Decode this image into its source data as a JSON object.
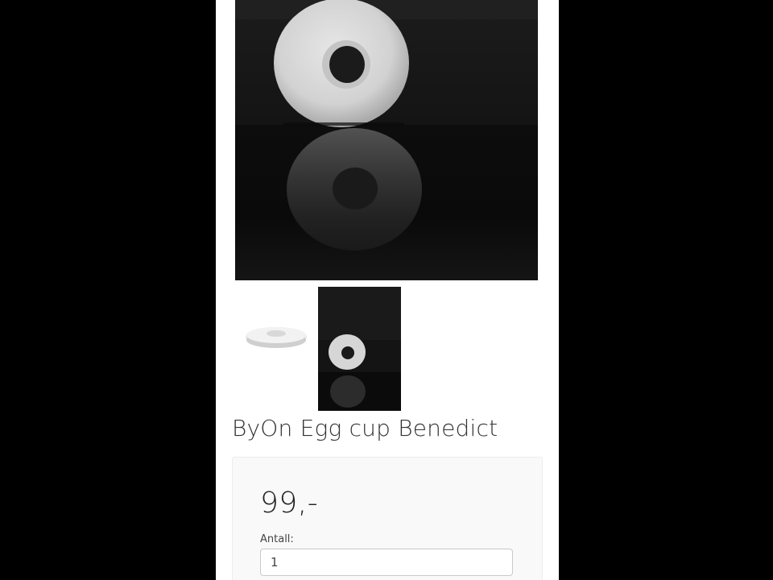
{
  "product": {
    "title": "ByOn Egg cup Benedict",
    "price": "99,-",
    "quantity_label": "Antall:",
    "quantity_value": "1"
  },
  "images": {
    "main": "product-photo-egg-cup-dark",
    "thumbnails": [
      "thumbnail-egg-cup-white",
      "thumbnail-egg-cup-dark"
    ]
  },
  "colors": {
    "page_background": "#000000",
    "content_background": "#ffffff",
    "photo_background": "#111111",
    "buy_box_background": "#f9f9f9"
  }
}
